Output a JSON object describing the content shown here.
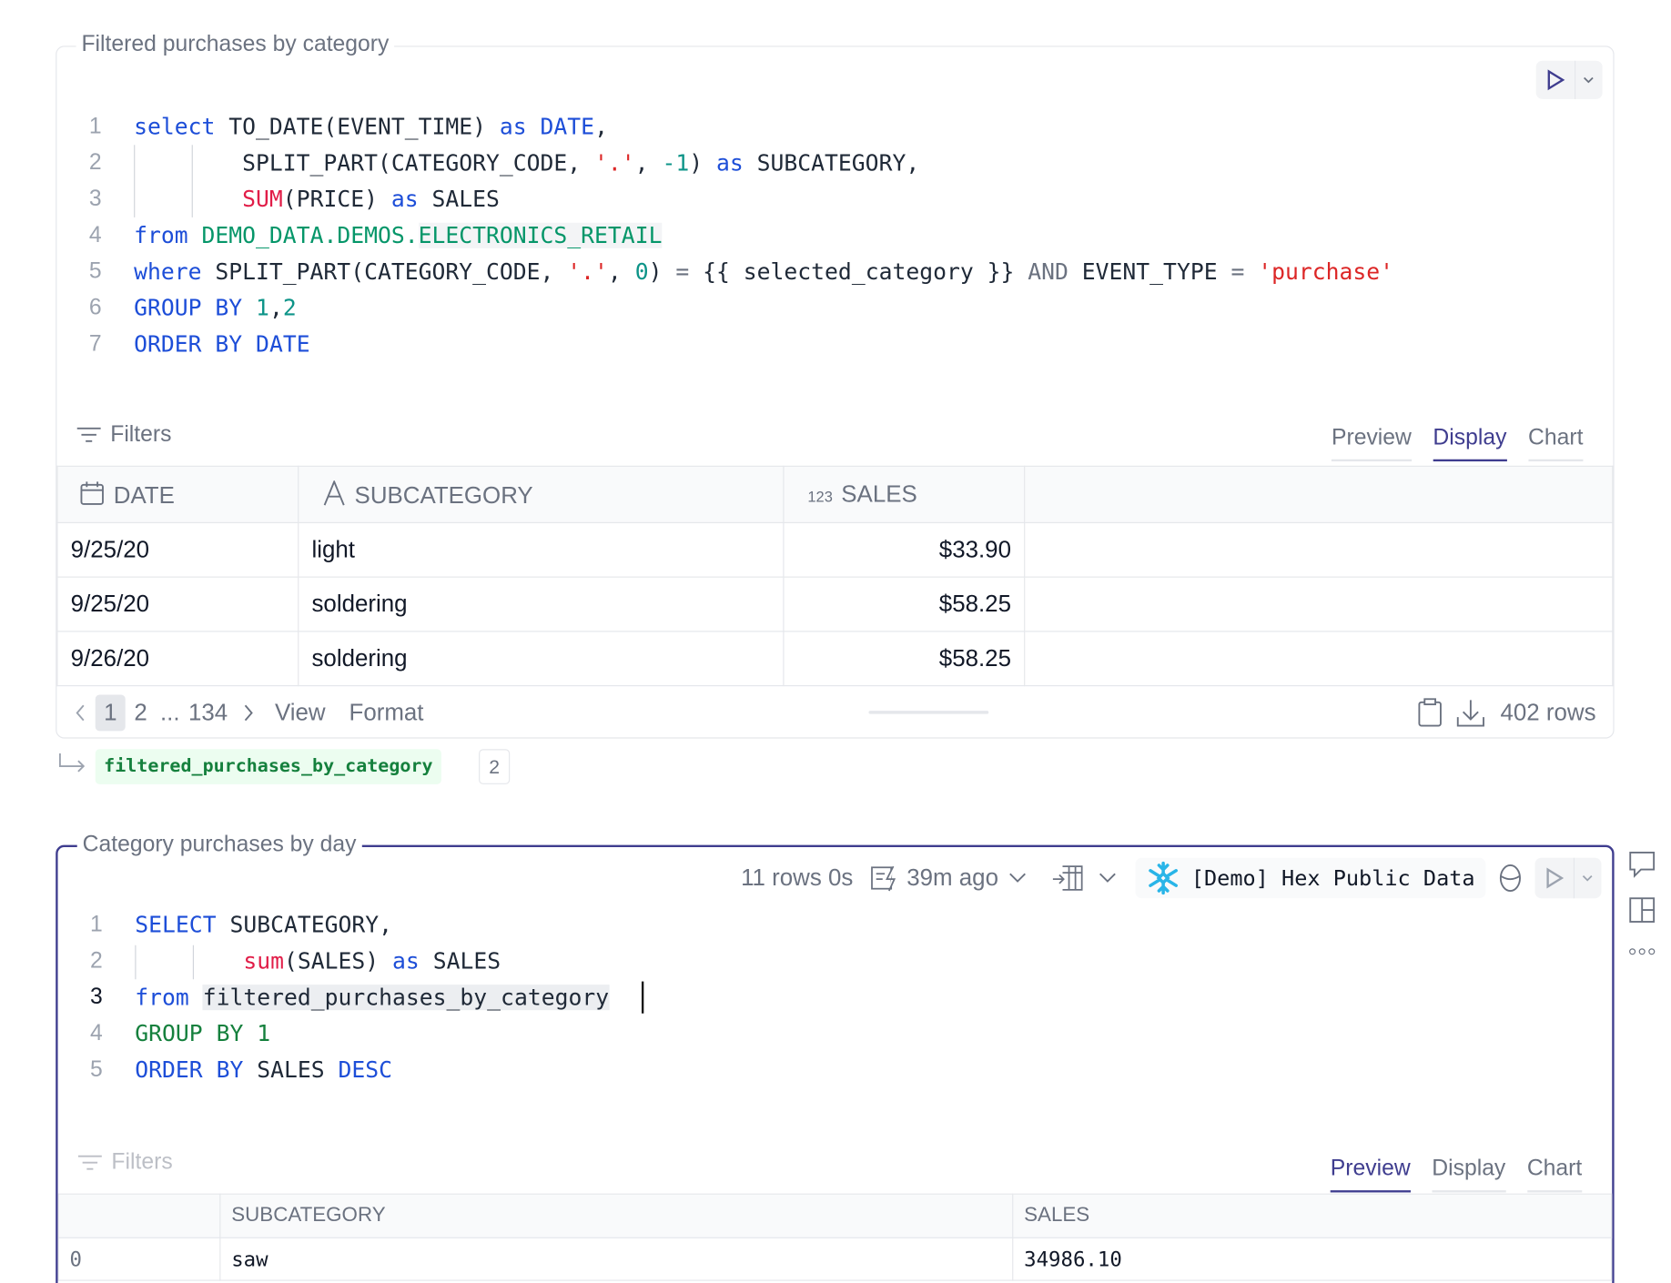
{
  "cell1": {
    "title": "Filtered purchases by category",
    "code": [
      {
        "n": "1",
        "t": [
          [
            "select",
            "kw"
          ],
          [
            " TO_DATE(EVENT_TIME) ",
            ""
          ],
          [
            "as",
            "kw"
          ],
          [
            " ",
            ""
          ],
          [
            "DATE",
            "kw"
          ],
          [
            ",",
            ""
          ]
        ]
      },
      {
        "n": "2",
        "t": [
          [
            "        SPLIT_PART(CATEGORY_CODE, ",
            ""
          ],
          [
            "'.'",
            "str"
          ],
          [
            ", ",
            ""
          ],
          [
            "-1",
            "num"
          ],
          [
            ") ",
            ""
          ],
          [
            "as",
            "kw"
          ],
          [
            " SUBCATEGORY,",
            ""
          ]
        ]
      },
      {
        "n": "3",
        "t": [
          [
            "        ",
            ""
          ],
          [
            "SUM",
            "fn"
          ],
          [
            "(PRICE) ",
            ""
          ],
          [
            "as",
            "kw"
          ],
          [
            " SALES",
            ""
          ]
        ]
      },
      {
        "n": "4",
        "t": [
          [
            "from",
            "kw"
          ],
          [
            " ",
            ""
          ],
          [
            "DEMO_DATA.DEMOS.",
            "tbl"
          ],
          [
            "ELECTRONICS_RETAIL",
            "tbl hl"
          ]
        ]
      },
      {
        "n": "5",
        "t": [
          [
            "where",
            "kw"
          ],
          [
            " SPLIT_PART(CATEGORY_CODE, ",
            ""
          ],
          [
            "'.'",
            "str"
          ],
          [
            ", ",
            ""
          ],
          [
            "0",
            "num"
          ],
          [
            ") ",
            ""
          ],
          [
            "=",
            "op"
          ],
          [
            " {{ selected_category }} ",
            ""
          ],
          [
            "AND",
            "op"
          ],
          [
            " EVENT_TYPE ",
            ""
          ],
          [
            "=",
            "op"
          ],
          [
            " ",
            ""
          ],
          [
            "'purchase'",
            "str"
          ]
        ]
      },
      {
        "n": "6",
        "t": [
          [
            "GROUP BY",
            "kw"
          ],
          [
            " ",
            ""
          ],
          [
            "1",
            "num"
          ],
          [
            ",",
            ""
          ],
          [
            "2",
            "num"
          ]
        ]
      },
      {
        "n": "7",
        "t": [
          [
            "ORDER BY",
            "kw"
          ],
          [
            " ",
            ""
          ],
          [
            "DATE",
            "kw"
          ]
        ]
      }
    ],
    "filters": "Filters",
    "tabs": [
      "Preview",
      "Display",
      "Chart"
    ],
    "columns": [
      {
        "type": "calendar",
        "label": "DATE"
      },
      {
        "type": "text",
        "label": "SUBCATEGORY"
      },
      {
        "type": "number",
        "type_label": "123",
        "label": "SALES"
      }
    ],
    "rows": [
      [
        "9/25/20",
        "light",
        "$33.90"
      ],
      [
        "9/25/20",
        "soldering",
        "$58.25"
      ],
      [
        "9/26/20",
        "soldering",
        "$58.25"
      ]
    ],
    "pager": {
      "current": "1",
      "next": "2",
      "ellipsis": "...",
      "last": "134",
      "view": "View",
      "format": "Format"
    },
    "row_count": "402 rows",
    "output_var": "filtered_purchases_by_category",
    "output_refs": "2"
  },
  "cell2": {
    "title": "Category purchases by day",
    "status": "11 rows 0s",
    "last_run": "39m ago",
    "connection": "[Demo] Hex Public Data",
    "code": [
      {
        "n": "1",
        "t": [
          [
            "SELECT",
            "kw"
          ],
          [
            " SUBCATEGORY,",
            ""
          ]
        ]
      },
      {
        "n": "2",
        "t": [
          [
            "        ",
            ""
          ],
          [
            "sum",
            "fn"
          ],
          [
            "(SALES) ",
            ""
          ],
          [
            "as",
            "kw"
          ],
          [
            " SALES",
            ""
          ]
        ]
      },
      {
        "n": "3",
        "t": [
          [
            "from",
            "kw"
          ],
          [
            " ",
            ""
          ],
          [
            "filtered_purchases_by_category",
            "hl2"
          ]
        ]
      },
      {
        "n": "4",
        "t": [
          [
            "GROUP BY",
            "gk"
          ],
          [
            " ",
            ""
          ],
          [
            "1",
            "gk"
          ]
        ]
      },
      {
        "n": "5",
        "t": [
          [
            "ORDER BY",
            "kw"
          ],
          [
            " SALES ",
            ""
          ],
          [
            "DESC",
            "kw"
          ]
        ]
      }
    ],
    "filters": "Filters",
    "tabs": [
      "Preview",
      "Display",
      "Chart"
    ],
    "columns": [
      "",
      "SUBCATEGORY",
      "SALES"
    ],
    "rows": [
      [
        "0",
        "saw",
        "34986.10"
      ]
    ]
  },
  "colors": {
    "accent": "#3f3d8f",
    "snowflake": "#29b5e8",
    "chip_bg": "#ecfdf0",
    "chip_text": "#15803d"
  }
}
